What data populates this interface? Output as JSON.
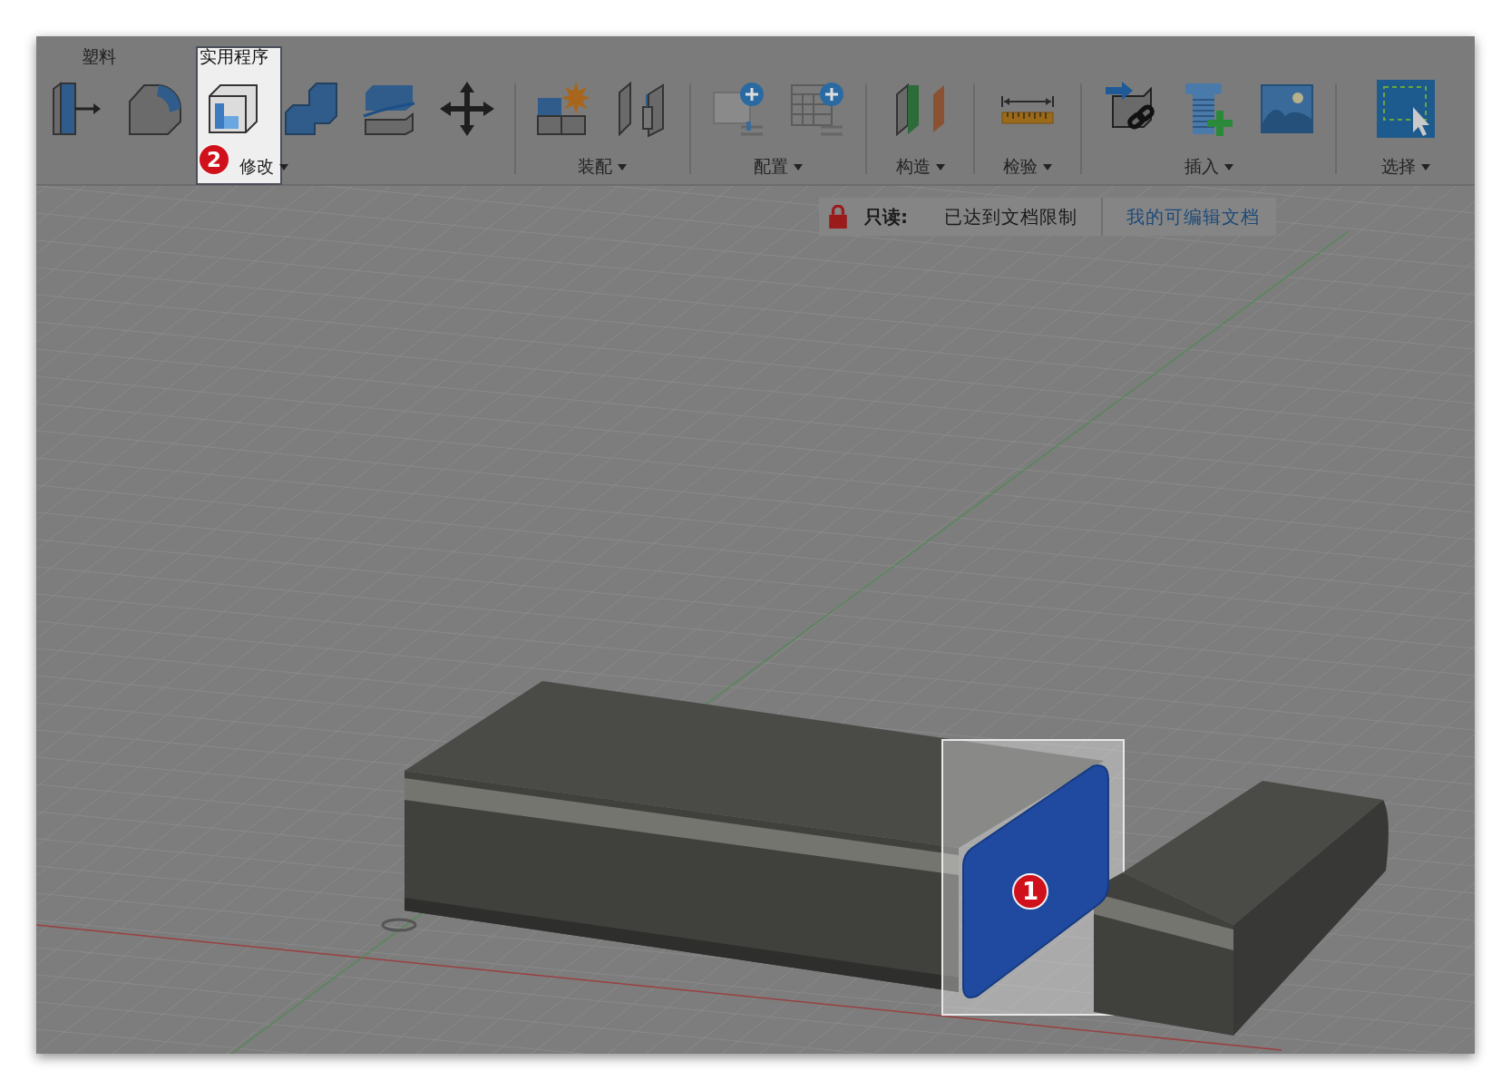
{
  "tabs": [
    {
      "label": "塑料",
      "selected": false
    },
    {
      "label": "实用程序",
      "selected": true
    }
  ],
  "groups": [
    {
      "label": "修改"
    },
    {
      "label": "装配"
    },
    {
      "label": "配置"
    },
    {
      "label": "构造"
    },
    {
      "label": "检验"
    },
    {
      "label": "插入"
    },
    {
      "label": "选择"
    }
  ],
  "banner": {
    "label": "只读:",
    "message": "已达到文档限制",
    "link": "我的可编辑文档"
  },
  "callouts": [
    {
      "label": "2"
    },
    {
      "label": "1"
    }
  ]
}
